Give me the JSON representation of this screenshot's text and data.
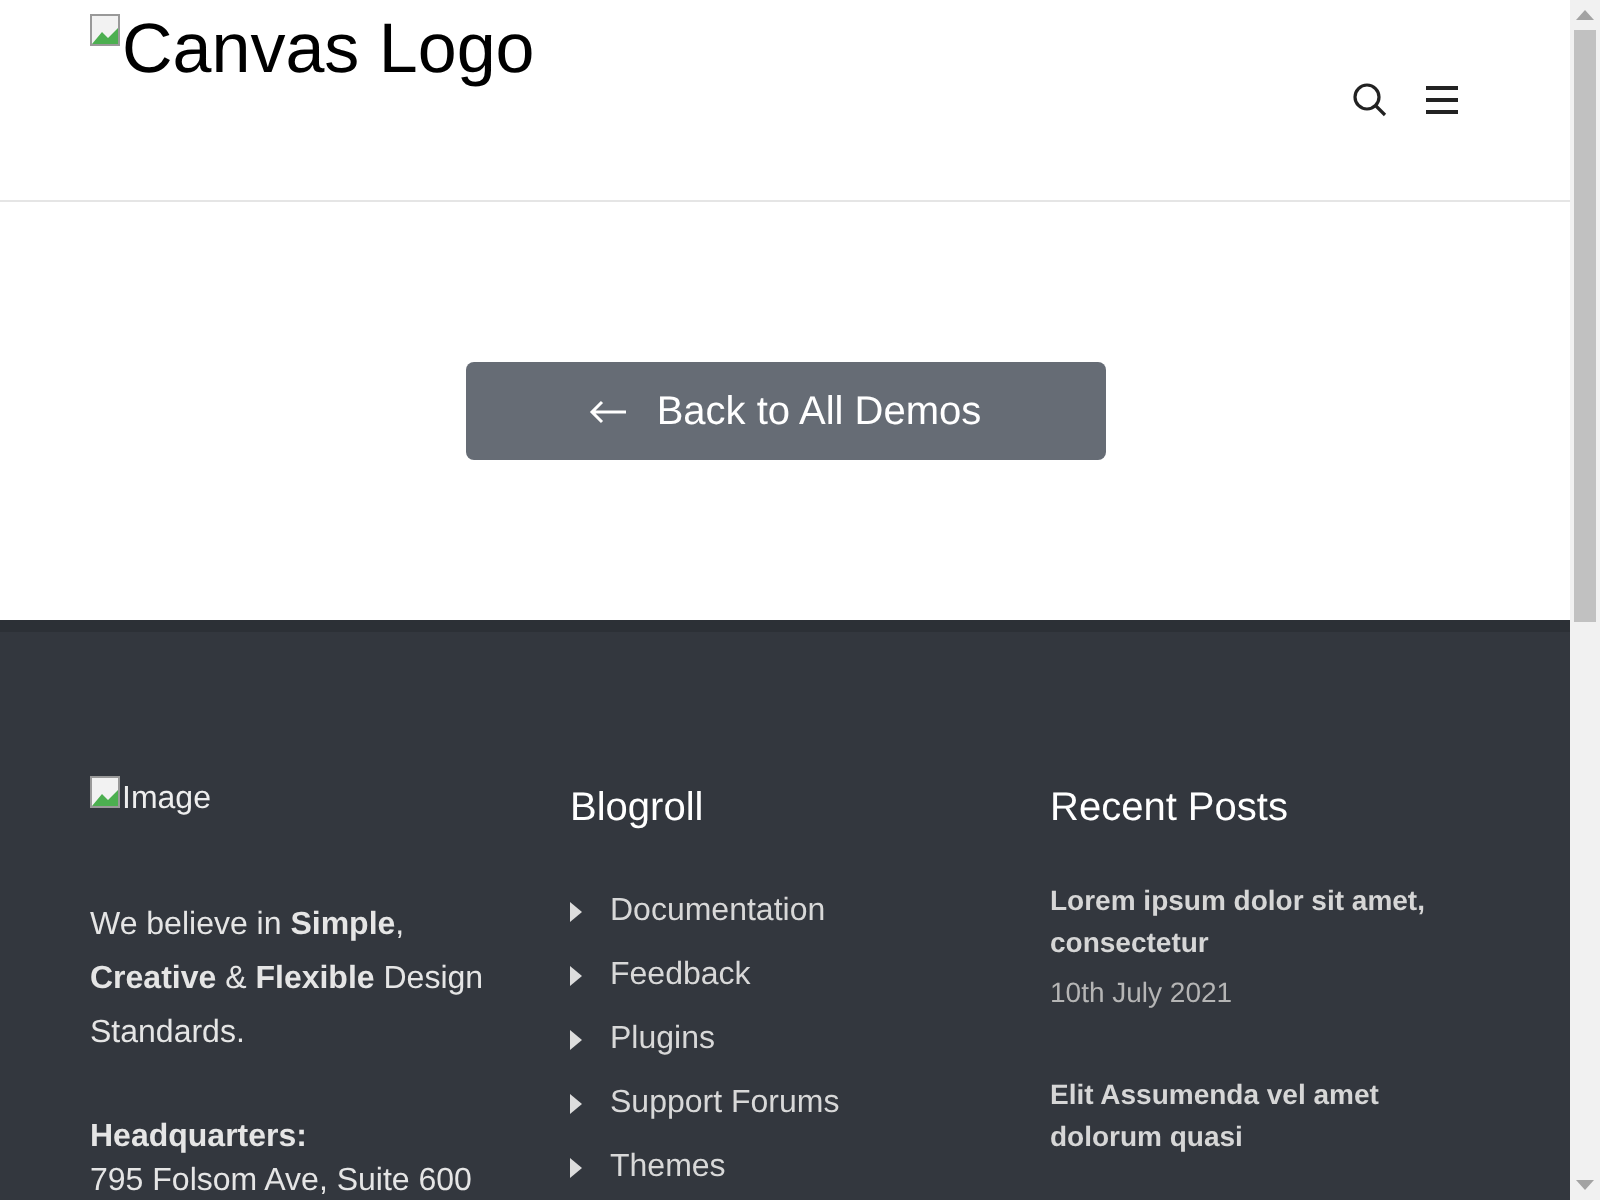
{
  "header": {
    "logo_alt": "Canvas Logo"
  },
  "hero": {
    "button": "Back to All Demos"
  },
  "footer": {
    "logo_alt": "Image",
    "about": "We believe in **Simple**, **Creative** & **Flexible** Design Standards.",
    "headquarters_label": "Headquarters:",
    "address": "795 Folsom Ave, Suite 600",
    "blogroll": {
      "title": "Blogroll",
      "links": [
        "Documentation",
        "Feedback",
        "Plugins",
        "Support Forums",
        "Themes"
      ]
    },
    "recent_posts": {
      "title": "Recent Posts",
      "posts": [
        {
          "title": "Lorem ipsum dolor sit amet, consectetur",
          "date": "10th July 2021"
        },
        {
          "title": "Elit Assumenda vel amet dolorum quasi"
        }
      ]
    }
  }
}
